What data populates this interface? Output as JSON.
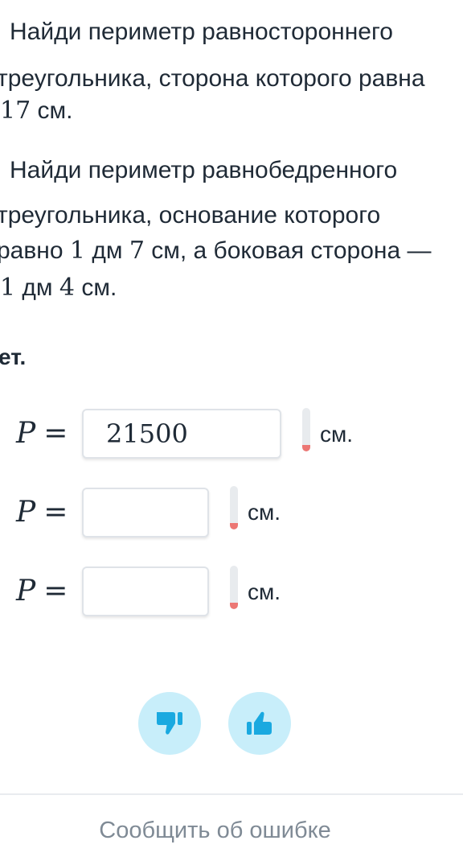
{
  "task2": {
    "line1": "Найди периметр равностороннего",
    "line2": "треугольника, сторона которого равна",
    "line3_num": "17",
    "line3_text": " см."
  },
  "task3": {
    "line1": "Найди периметр равнобедренного",
    "line2": "треугольника, основание которого",
    "line3_a": "равно ",
    "line3_n1": "1",
    "line3_b": " дм ",
    "line3_n2": "7",
    "line3_c": " см, а боковая сторона —",
    "line4_n1": "1",
    "line4_a": " дм ",
    "line4_n2": "4",
    "line4_b": " см."
  },
  "answer_heading": "ет.",
  "answers": [
    {
      "var": "P",
      "eq": "=",
      "value": "21500",
      "unit": "см."
    },
    {
      "var": "P",
      "eq": "=",
      "value": "",
      "unit": "см."
    },
    {
      "var": "P",
      "eq": "=",
      "value": "",
      "unit": "см."
    }
  ],
  "rating": {
    "dislike_icon": "thumbs-down-icon",
    "like_icon": "thumbs-up-icon",
    "icon_color": "#1aa9e0",
    "button_color": "#c8eefa"
  },
  "footer": {
    "report_label": "Сообщить об ошибке"
  }
}
